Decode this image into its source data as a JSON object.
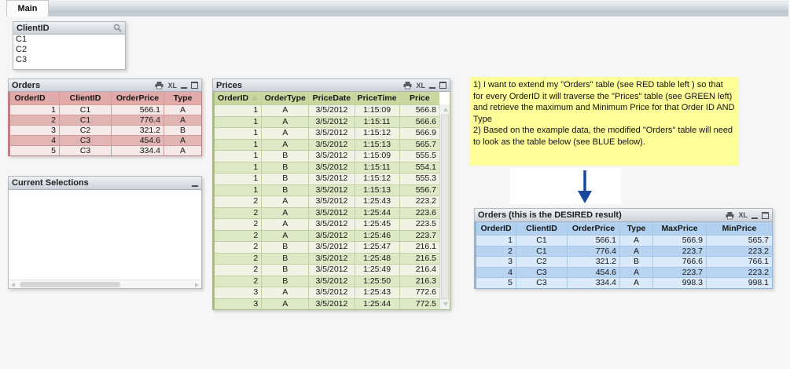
{
  "tab": {
    "label": "Main"
  },
  "icons": {
    "excel_label": "XL",
    "caption_icons": [
      "printer-icon",
      "excel-icon",
      "minimize-icon",
      "maximize-icon"
    ],
    "listbox_icon": "search-icon",
    "sort_icon": "sort-ascending-icon",
    "arrow_icon": "arrow-down-icon"
  },
  "listbox": {
    "title": "ClientID",
    "items": [
      "C1",
      "C2",
      "C3"
    ]
  },
  "orders_table": {
    "title": "Orders",
    "headers": [
      "OrderID",
      "ClientID",
      "OrderPrice",
      "Type"
    ],
    "rows": [
      [
        1,
        "C1",
        566.1,
        "A"
      ],
      [
        2,
        "C1",
        776.4,
        "A"
      ],
      [
        3,
        "C2",
        321.2,
        "B"
      ],
      [
        4,
        "C3",
        454.6,
        "A"
      ],
      [
        5,
        "C3",
        334.4,
        "A"
      ]
    ]
  },
  "current_selections": {
    "title": "Current Selections"
  },
  "prices_table": {
    "title": "Prices",
    "headers": [
      "OrderID",
      "OrderType",
      "PriceDate",
      "PriceTime",
      "Price"
    ],
    "rows": [
      [
        1,
        "A",
        "3/5/2012",
        "1:15:09",
        566.8
      ],
      [
        1,
        "A",
        "3/5/2012",
        "1:15:11",
        566.6
      ],
      [
        1,
        "A",
        "3/5/2012",
        "1:15:12",
        566.9
      ],
      [
        1,
        "A",
        "3/5/2012",
        "1:15:13",
        565.7
      ],
      [
        1,
        "B",
        "3/5/2012",
        "1:15:09",
        555.5
      ],
      [
        1,
        "B",
        "3/5/2012",
        "1:15:11",
        554.1
      ],
      [
        1,
        "B",
        "3/5/2012",
        "1:15:12",
        555.3
      ],
      [
        1,
        "B",
        "3/5/2012",
        "1:15:13",
        556.7
      ],
      [
        2,
        "A",
        "3/5/2012",
        "1:25:43",
        223.2
      ],
      [
        2,
        "A",
        "3/5/2012",
        "1:25:44",
        223.6
      ],
      [
        2,
        "A",
        "3/5/2012",
        "1:25:45",
        223.5
      ],
      [
        2,
        "A",
        "3/5/2012",
        "1:25:46",
        223.7
      ],
      [
        2,
        "B",
        "3/5/2012",
        "1:25:47",
        216.1
      ],
      [
        2,
        "B",
        "3/5/2012",
        "1:25:48",
        216.5
      ],
      [
        2,
        "B",
        "3/5/2012",
        "1:25:49",
        216.4
      ],
      [
        2,
        "B",
        "3/5/2012",
        "1:25:50",
        216.3
      ],
      [
        3,
        "A",
        "3/5/2012",
        "1:25:43",
        772.6
      ],
      [
        3,
        "A",
        "3/5/2012",
        "1:25:44",
        772.5
      ]
    ]
  },
  "note": {
    "line1": "1) I want to extend my \"Orders\" table (see RED table left ) so that for every OrderID it will traverse the \"Prices\" table (see GREEN left) and retrieve the maximum and Minimum Price for that Order ID AND Type",
    "line2": "2) Based on the example data, the modified \"Orders\" table will need to look as the table below (see BLUE below)."
  },
  "result_table": {
    "title": "Orders  (this is the DESIRED result)",
    "headers": [
      "OrderID",
      "ClientID",
      "OrderPrice",
      "Type",
      "MaxPrice",
      "MinPrice"
    ],
    "rows": [
      [
        1,
        "C1",
        566.1,
        "A",
        566.9,
        565.7
      ],
      [
        2,
        "C1",
        776.4,
        "A",
        223.7,
        223.2
      ],
      [
        3,
        "C2",
        321.2,
        "B",
        766.6,
        766.1
      ],
      [
        4,
        "C3",
        454.6,
        "A",
        223.7,
        223.2
      ],
      [
        5,
        "C3",
        334.4,
        "A",
        998.3,
        998.1
      ]
    ]
  },
  "colors": {
    "red_header": "#e2a9a9",
    "red_row_light": "#f6e9e9",
    "red_row_dark": "#e2b5b5",
    "green_header": "#c9d89e",
    "green_row_light": "#f0f3e3",
    "green_row_dark": "#dde8c4",
    "blue_header": "#b2d0f0",
    "blue_row_light": "#dbeafa",
    "blue_row_dark": "#b9d4f1",
    "note_background": "#ffff99",
    "arrow_blue": "#17489c"
  }
}
